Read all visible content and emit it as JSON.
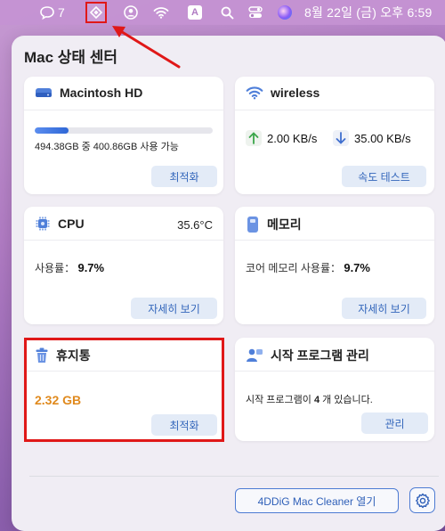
{
  "menubar": {
    "chat_count": "7",
    "clock": "8월 22일 (금) 오후  6:59",
    "input_source": "A",
    "icons": [
      "chat-bubble-icon",
      "app-diamond-icon",
      "user-icon",
      "wifi-icon",
      "input-source-icon",
      "search-icon",
      "control-center-icon",
      "siri-icon"
    ]
  },
  "panel": {
    "title": "Mac 상태 센터"
  },
  "disk": {
    "title": "Macintosh HD",
    "usage_text": "494.38GB 중 400.86GB 사용 가능",
    "used_fraction": 0.19,
    "button": "최적화"
  },
  "network": {
    "title": "wireless",
    "upload": "2.00 KB/s",
    "download": "35.00 KB/s",
    "button": "속도 테스트"
  },
  "cpu": {
    "title": "CPU",
    "temperature": "35.6°C",
    "usage_label": "사용률：",
    "usage_value": "9.7%",
    "button": "자세히 보기"
  },
  "memory": {
    "title": "메모리",
    "usage_label": "코어 메모리 사용률：",
    "usage_value": "9.7%",
    "button": "자세히 보기"
  },
  "trash": {
    "title": "휴지통",
    "size": "2.32  GB",
    "button": "최적화"
  },
  "startup": {
    "title": "시작 프로그램 관리",
    "text_prefix": "시작 프로그램이 ",
    "count": "4",
    "text_suffix": " 개 있습니다.",
    "button": "관리"
  },
  "footer": {
    "open_button": "4DDiG Mac Cleaner 열기"
  },
  "colors": {
    "accent": "#2e5fb8",
    "trash_size": "#e08a1e",
    "annotation": "#e01818"
  }
}
